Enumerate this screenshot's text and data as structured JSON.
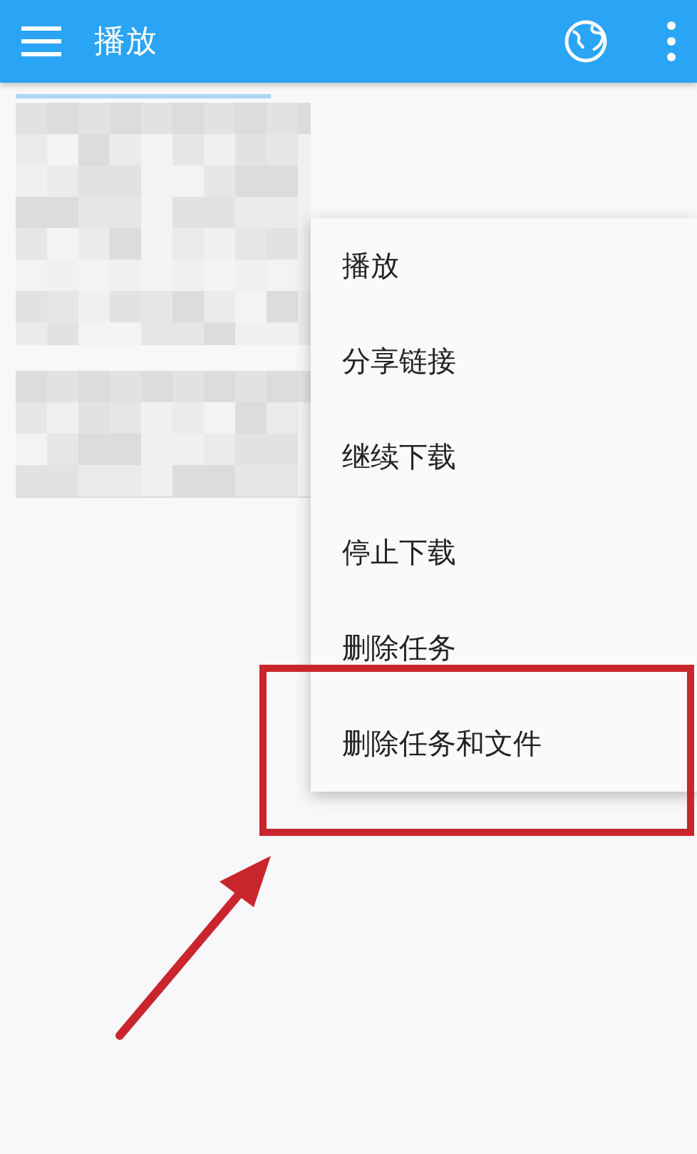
{
  "app_bar": {
    "title": "播放"
  },
  "context_menu": {
    "items": [
      {
        "label": "播放"
      },
      {
        "label": "分享链接"
      },
      {
        "label": "继续下载"
      },
      {
        "label": "停止下载"
      },
      {
        "label": "删除任务"
      },
      {
        "label": "删除任务和文件"
      }
    ]
  }
}
